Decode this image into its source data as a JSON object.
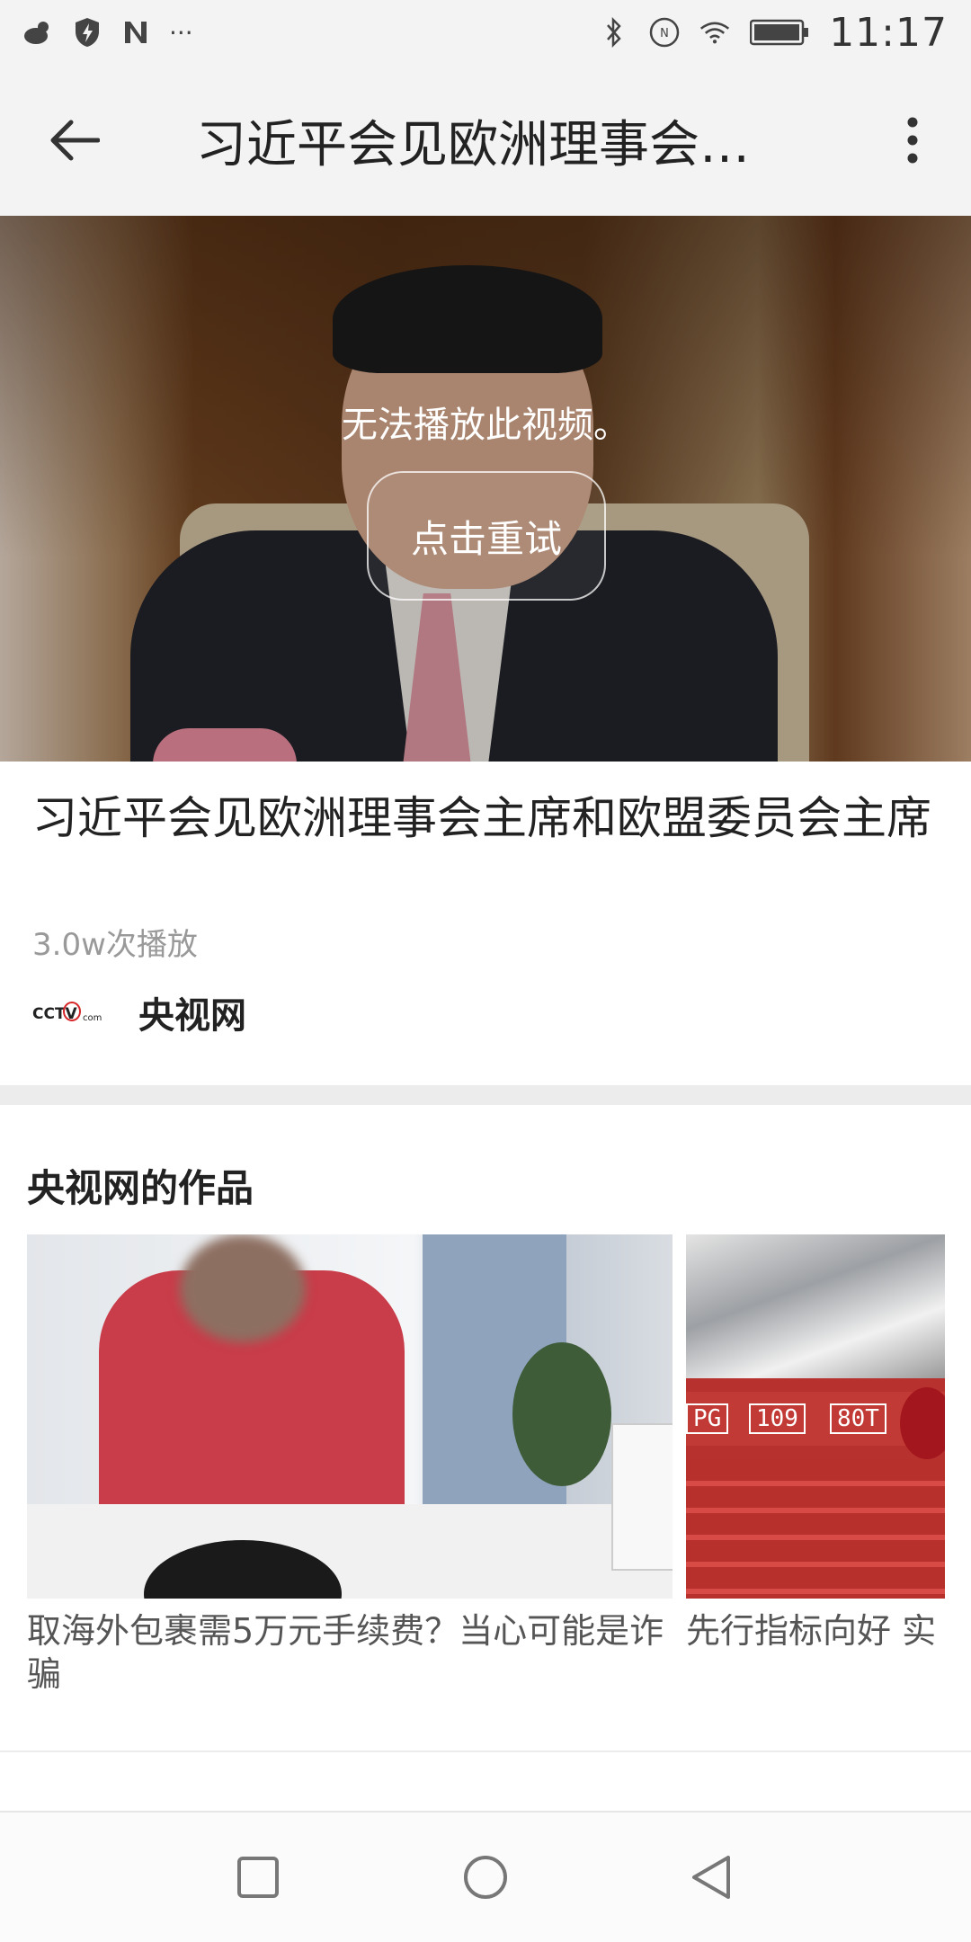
{
  "status_bar": {
    "time": "11:17",
    "left_icons": [
      "weather-icon",
      "shield-icon",
      "n-icon"
    ],
    "overflow": "···",
    "right_icons": [
      "bluetooth-icon",
      "nfc-icon",
      "wifi-icon",
      "battery-icon"
    ]
  },
  "app_bar": {
    "title": "习近平会见欧洲理事会…",
    "back_icon": "arrow-left-icon",
    "more_icon": "vertical-dots-icon"
  },
  "video": {
    "error_message": "无法播放此视频。",
    "retry_label": "点击重试"
  },
  "video_info": {
    "title": "习近平会见欧洲理事会主席和欧盟委员会主席",
    "play_count": "3.0w次播放",
    "channel_name": "央视网",
    "channel_logo": "cctv-logo"
  },
  "works_section": {
    "title": "央视网的作品",
    "items": [
      {
        "caption": "取海外包裹需5万元手续费？当心可能是诈骗"
      },
      {
        "caption": "先行指标向好 实"
      }
    ],
    "thumb2_labels": [
      "PG",
      "109",
      "80T"
    ]
  },
  "nav_bar": {
    "buttons": [
      "recents-square-icon",
      "home-circle-icon",
      "back-triangle-icon"
    ]
  }
}
